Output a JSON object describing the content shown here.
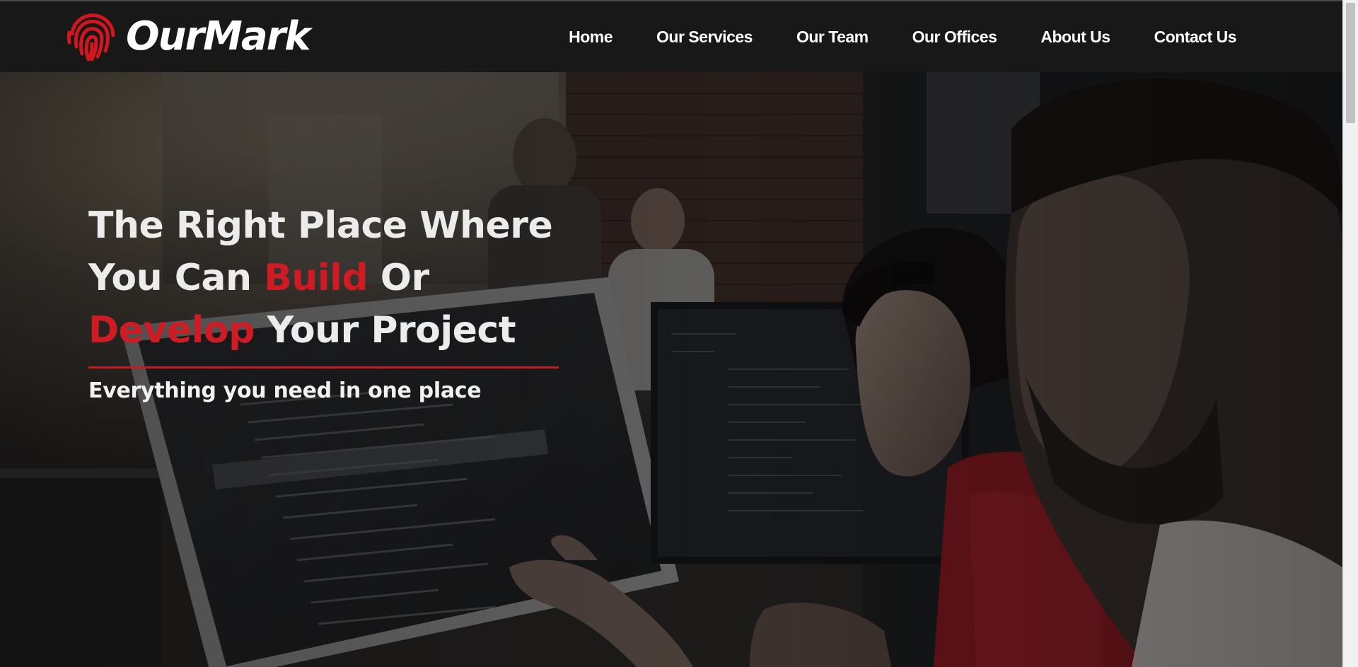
{
  "brand": {
    "name": "OurMark",
    "accent_color": "#d0161e"
  },
  "nav": {
    "items": [
      {
        "label": "Home"
      },
      {
        "label": "Our Services"
      },
      {
        "label": "Our Team"
      },
      {
        "label": "Our Offices"
      },
      {
        "label": "About Us"
      },
      {
        "label": "Contact Us"
      }
    ]
  },
  "hero": {
    "line1": "The Right Place Where",
    "line2_a": "You Can ",
    "line2_accent": "Build",
    "line2_b": " Or",
    "line3_accent": "Develop",
    "line3_b": " Your Project",
    "subtitle": "Everything you need in one place",
    "accent_color": "#cf1b24",
    "background_image": "people-working-at-computers-photo"
  },
  "scrollbar": {
    "position": 0
  }
}
